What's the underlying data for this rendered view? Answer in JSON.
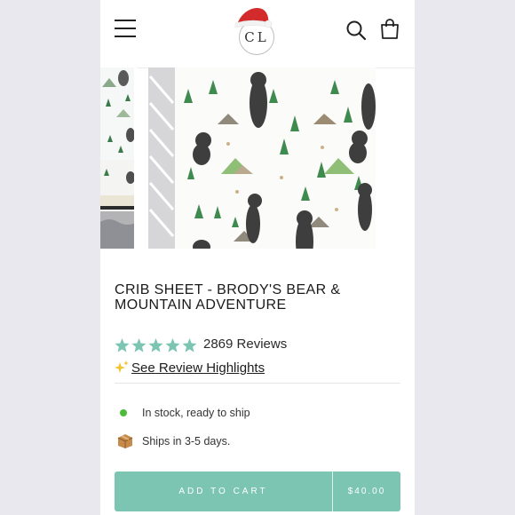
{
  "header": {
    "logo_text": "CL",
    "icons": [
      "hamburger-menu-icon",
      "santa-hat-icon",
      "search-icon",
      "shopping-bag-icon"
    ]
  },
  "gallery": {
    "zoom_icon": "magnifier-icon"
  },
  "product": {
    "title": "CRIB SHEET - BRODY'S BEAR & MOUNTAIN ADVENTURE",
    "rating_stars": 5,
    "reviews_text": "2869 Reviews",
    "highlights_link": "See Review Highlights",
    "stock_text": "In stock, ready to ship",
    "shipping_text": "Ships in 3-5 days."
  },
  "cart": {
    "button_label": "ADD TO CART",
    "price": "$40.00"
  },
  "colors": {
    "accent": "#7cc5b3",
    "star": "#7cc5b3",
    "in_stock": "#4cbb3a",
    "hat_red": "#d32b2b"
  }
}
